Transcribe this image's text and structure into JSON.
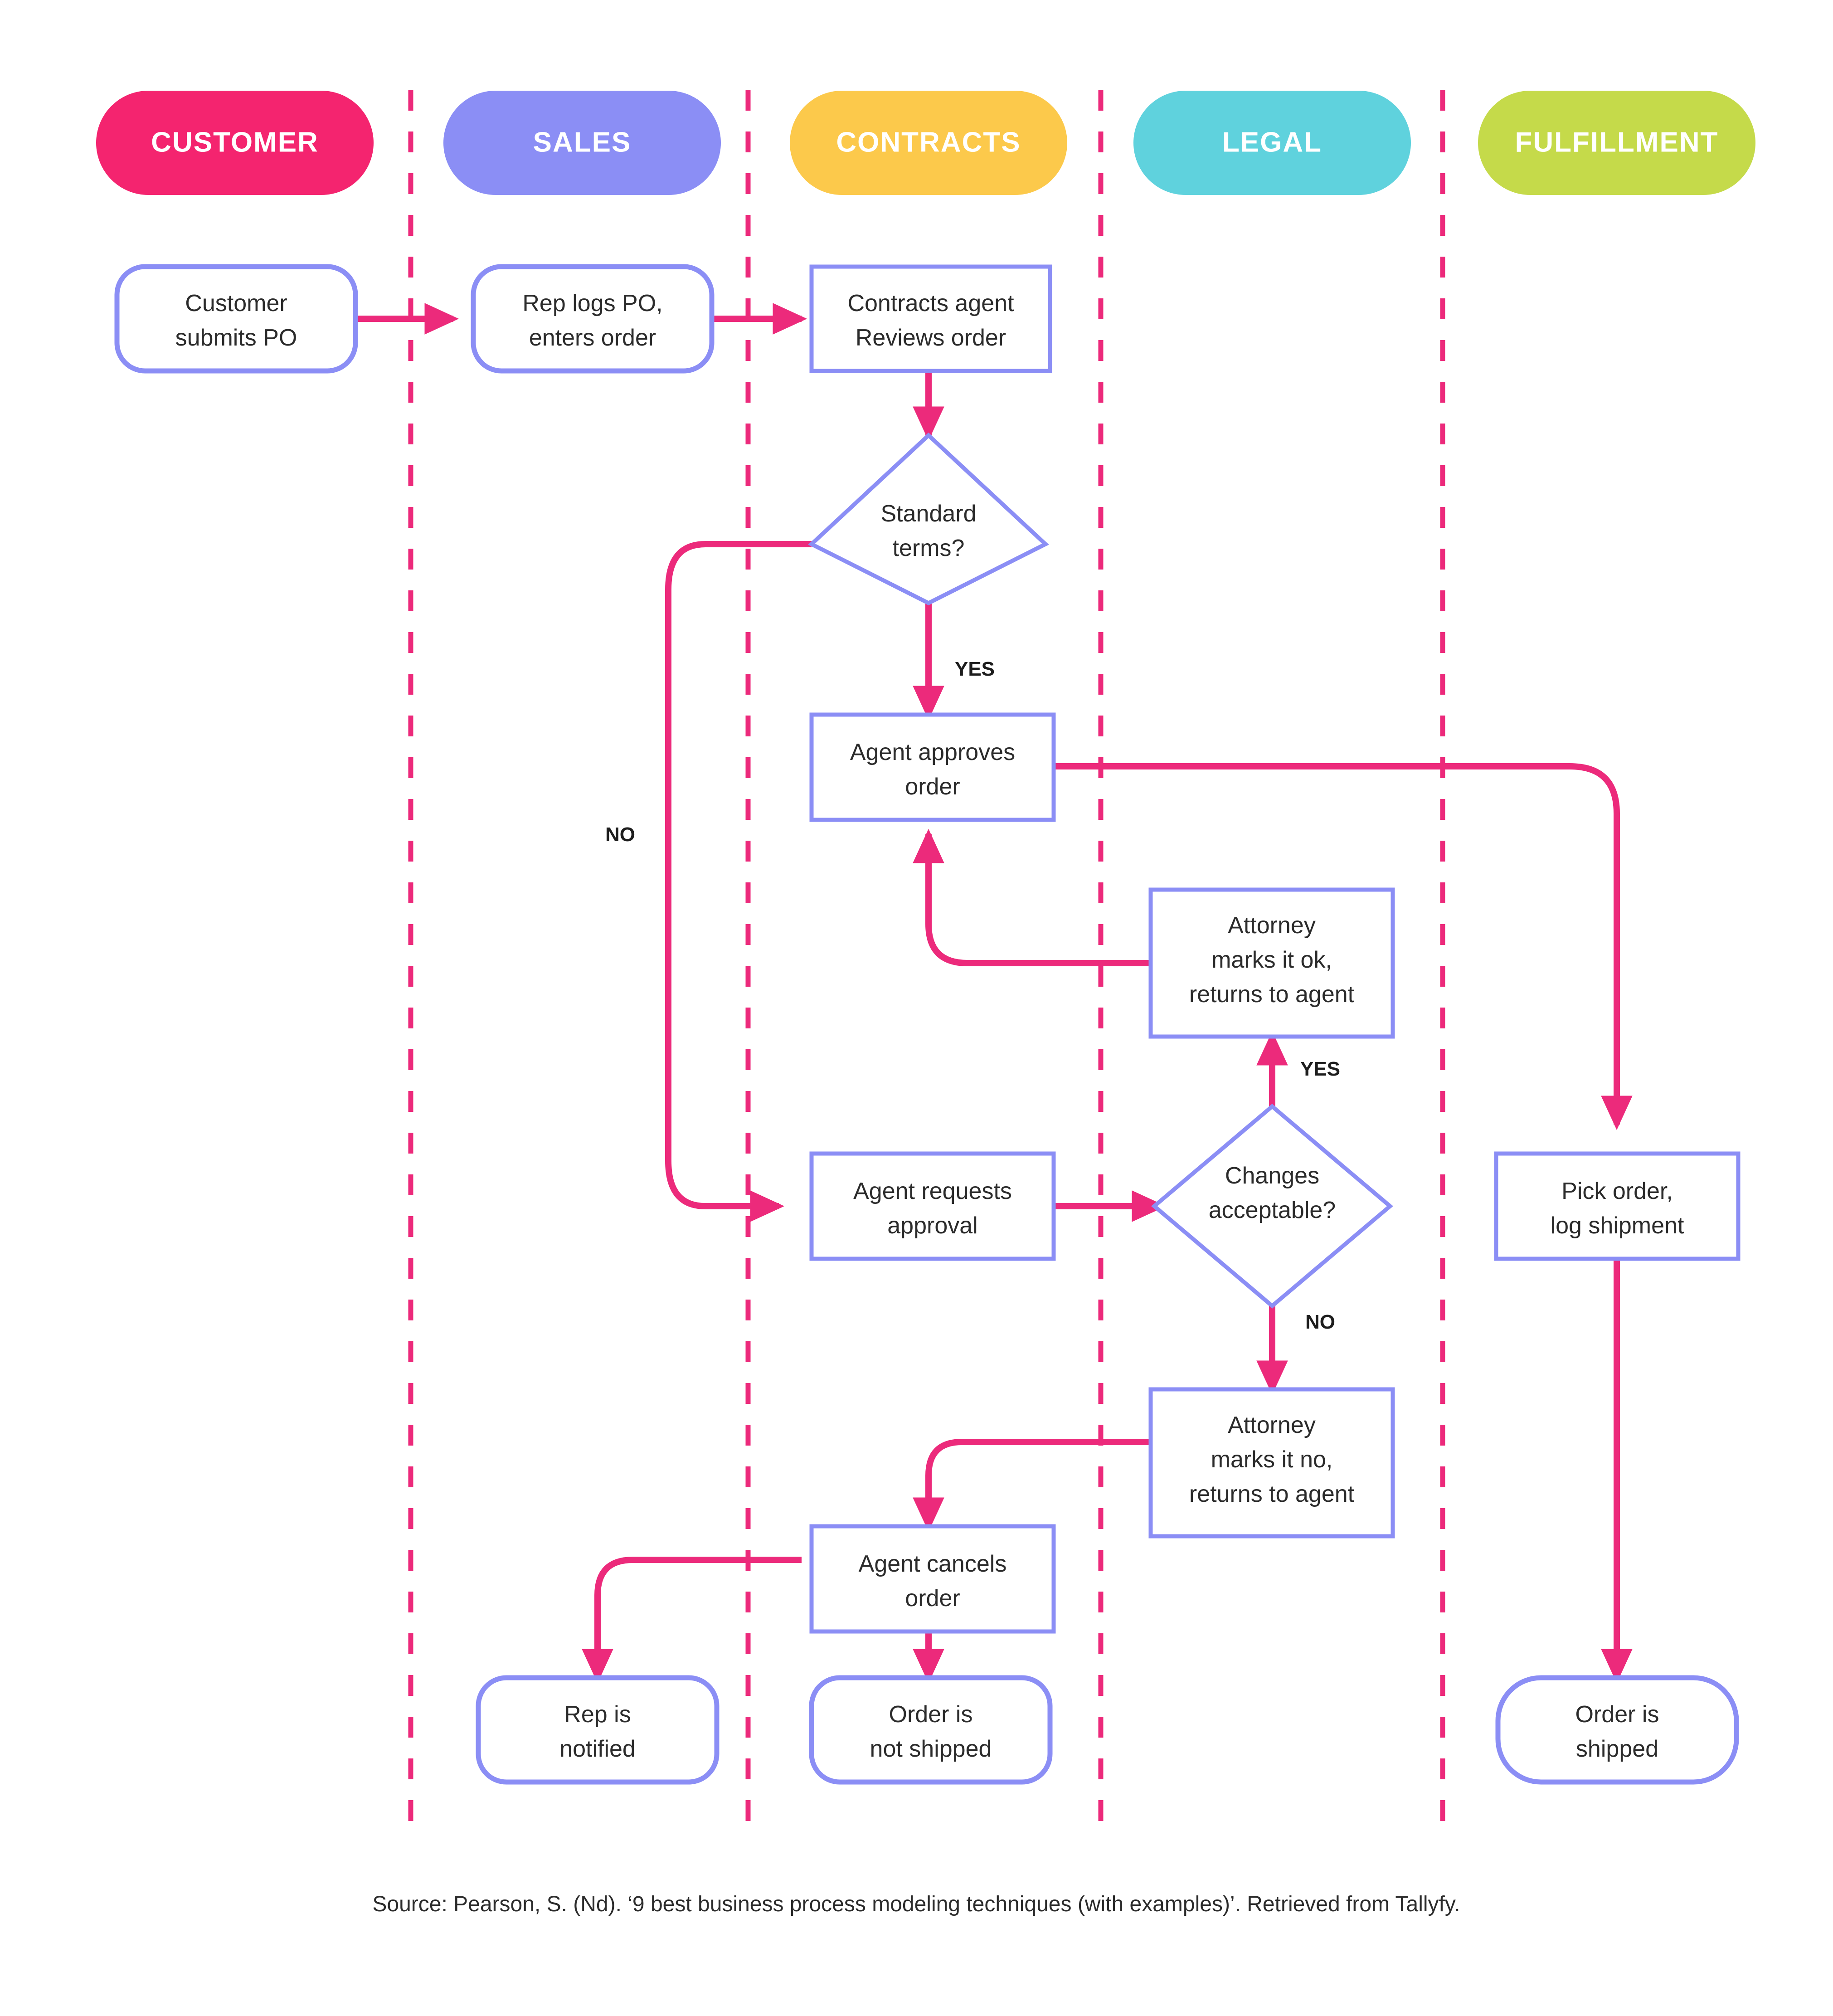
{
  "diagram": {
    "title": "Order-to-ship swimlane flowchart",
    "colors": {
      "customer_lane": "#f4246f",
      "sales_lane": "#8b8ef5",
      "contracts_lane": "#fcc94b",
      "legal_lane": "#5fd2dd",
      "fulfillment_lane": "#c5da4a",
      "connector": "#ec2a7b",
      "node_border": "#8b8ef5",
      "node_fill": "#ffffff",
      "node_text": "#2b2b2b",
      "lane_label_text": "#ffffff"
    },
    "lanes": [
      {
        "id": "customer",
        "label": "CUSTOMER",
        "color": "#f4246f"
      },
      {
        "id": "sales",
        "label": "SALES",
        "color": "#8b8ef5"
      },
      {
        "id": "contracts",
        "label": "CONTRACTS",
        "color": "#fcc94b"
      },
      {
        "id": "legal",
        "label": "LEGAL",
        "color": "#5fd2dd"
      },
      {
        "id": "fulfillment",
        "label": "FULFILLMENT",
        "color": "#c5da4a"
      }
    ],
    "nodes": [
      {
        "id": "customer_submits_po",
        "lane": "customer",
        "shape": "terminator",
        "line1": "Customer",
        "line2": "submits PO"
      },
      {
        "id": "rep_logs_po",
        "lane": "sales",
        "shape": "terminator",
        "line1": "Rep logs PO,",
        "line2": "enters order"
      },
      {
        "id": "contracts_reviews",
        "lane": "contracts",
        "shape": "process",
        "line1": "Contracts agent",
        "line2": "Reviews order"
      },
      {
        "id": "standard_terms",
        "lane": "contracts",
        "shape": "decision",
        "line1": "Standard",
        "line2": "terms?"
      },
      {
        "id": "agent_approves",
        "lane": "contracts",
        "shape": "process",
        "line1": "Agent approves",
        "line2": "order"
      },
      {
        "id": "attorney_marks_ok",
        "lane": "legal",
        "shape": "process",
        "line1": "Attorney",
        "line2": "marks it ok,",
        "line3": "returns to agent"
      },
      {
        "id": "agent_requests",
        "lane": "contracts",
        "shape": "process",
        "line1": "Agent requests",
        "line2": "approval"
      },
      {
        "id": "changes_acceptable",
        "lane": "legal",
        "shape": "decision",
        "line1": "Changes",
        "line2": "acceptable?"
      },
      {
        "id": "pick_order",
        "lane": "fulfillment",
        "shape": "process",
        "line1": "Pick order,",
        "line2": "log shipment"
      },
      {
        "id": "attorney_marks_no",
        "lane": "legal",
        "shape": "process",
        "line1": "Attorney",
        "line2": "marks it no,",
        "line3": "returns to agent"
      },
      {
        "id": "agent_cancels",
        "lane": "contracts",
        "shape": "process",
        "line1": "Agent cancels",
        "line2": "order"
      },
      {
        "id": "rep_is_notified",
        "lane": "sales",
        "shape": "terminator",
        "line1": "Rep is",
        "line2": "notified"
      },
      {
        "id": "order_not_shipped",
        "lane": "contracts",
        "shape": "terminator",
        "line1": "Order is",
        "line2": "not shipped"
      },
      {
        "id": "order_is_shipped",
        "lane": "fulfillment",
        "shape": "terminator",
        "line1": "Order is",
        "line2": "shipped"
      }
    ],
    "branch_labels": {
      "standard_terms_yes": "YES",
      "standard_terms_no": "NO",
      "changes_acceptable_yes": "YES",
      "changes_acceptable_no": "NO"
    },
    "caption": "Source: Pearson, S. (Nd). ‘9 best business process modeling techniques (with examples)’. Retrieved from Tallyfy."
  }
}
